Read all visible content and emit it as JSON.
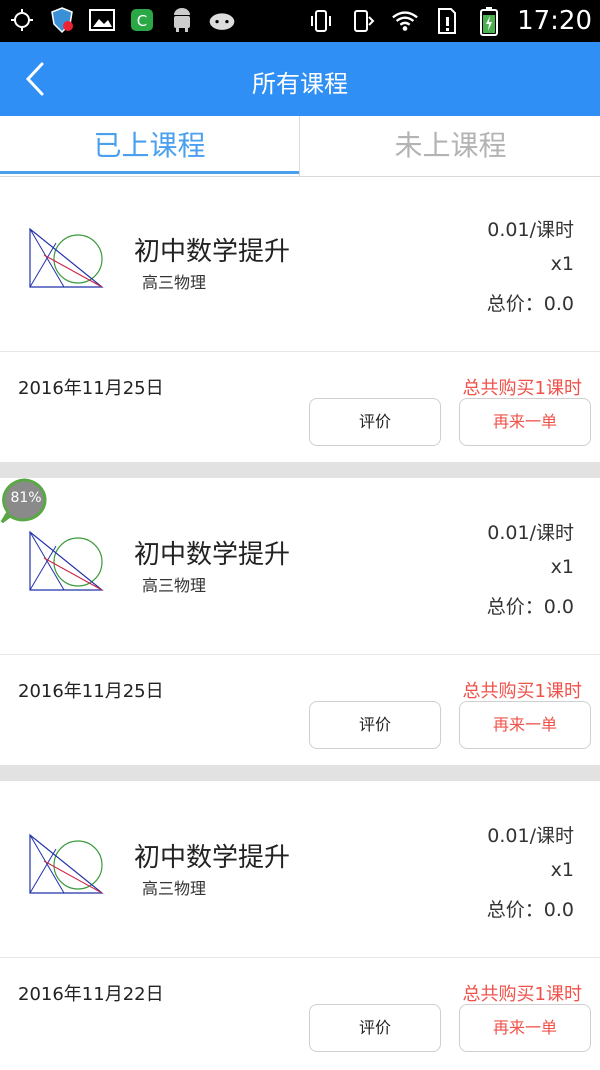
{
  "status_bar": {
    "time": "17:20"
  },
  "header": {
    "title": "所有课程"
  },
  "tabs": [
    {
      "label": "已上课程"
    },
    {
      "label": "未上课程"
    }
  ],
  "progress_bubble": {
    "text": "81%"
  },
  "cards": [
    {
      "title": "初中数学提升",
      "subtitle": "高三物理",
      "price": "0.01/课时",
      "qty": "x1",
      "total": "总价：0.0",
      "date": "2016年11月25日",
      "purchased": "总共购买1课时",
      "review_label": "评价",
      "reorder_label": "再来一单"
    },
    {
      "title": "初中数学提升",
      "subtitle": "高三物理",
      "price": "0.01/课时",
      "qty": "x1",
      "total": "总价：0.0",
      "date": "2016年11月25日",
      "purchased": "总共购买1课时",
      "review_label": "评价",
      "reorder_label": "再来一单"
    },
    {
      "title": "初中数学提升",
      "subtitle": "高三物理",
      "price": "0.01/课时",
      "qty": "x1",
      "total": "总价：0.0",
      "date": "2016年11月22日",
      "purchased": "总共购买1课时",
      "review_label": "评价",
      "reorder_label": "再来一单"
    }
  ],
  "colors": {
    "header_bg": "#2f8ff5",
    "active_tab": "#4aa0ee",
    "accent_red": "#f0524a"
  }
}
